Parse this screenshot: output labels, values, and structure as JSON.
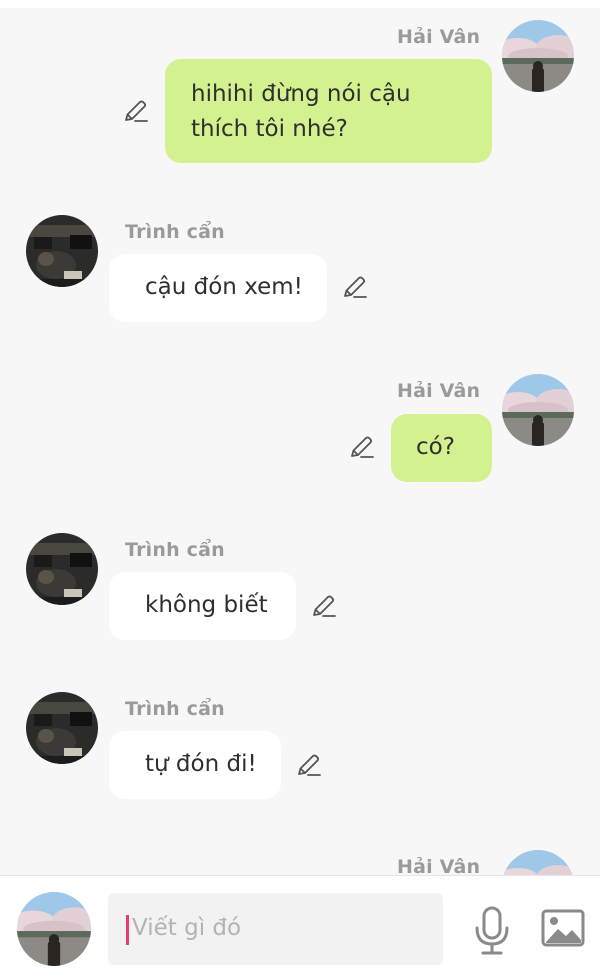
{
  "messages": [
    {
      "sender": "Hải Vân",
      "text_line1": "hihihi đừng nói cậu",
      "text_line2": "thích tôi nhé?"
    },
    {
      "sender": "Trình cẩn",
      "text": "cậu đón xem!"
    },
    {
      "sender": "Hải Vân",
      "text": "có?"
    },
    {
      "sender": "Trình cẩn",
      "text": "không biết"
    },
    {
      "sender": "Trình cẩn",
      "text": "tự đón đi!"
    },
    {
      "sender": "Hải Vân"
    }
  ],
  "composer": {
    "placeholder": "Viết gì đó"
  },
  "icons": {
    "edit": "pencil-icon",
    "mic": "microphone-icon",
    "image": "image-icon"
  },
  "colors": {
    "my_bubble": "#d4f18f",
    "other_bubble": "#ffffff",
    "caret": "#e83c7a",
    "background": "#f7f7f7"
  }
}
